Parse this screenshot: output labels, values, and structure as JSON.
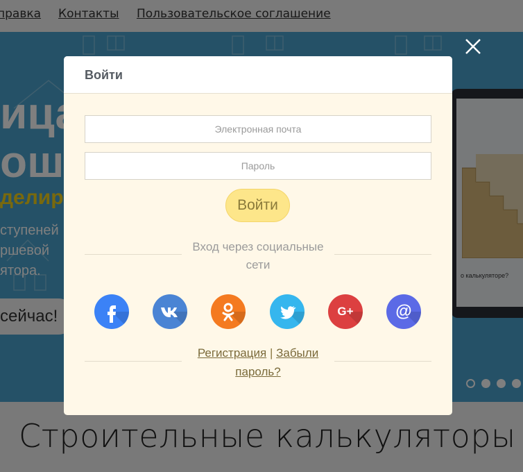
{
  "top_nav": {
    "items": [
      "правка",
      "Контакты",
      "Пользовательское соглашение"
    ]
  },
  "hero": {
    "title_line1": "ица",
    "title_line2": "ошен",
    "accent_text": "делир",
    "text": "ступеней\nршевой\nятора.",
    "button_label": "сейчас!",
    "laptop_question": "о калькуляторе?"
  },
  "slider": {
    "dot_count": 4,
    "active_index": 0
  },
  "page_heading": "Строительные калькуляторы",
  "modal": {
    "title": "Войти",
    "email_placeholder": "Электронная почта",
    "password_placeholder": "Пароль",
    "submit_label": "Войти",
    "social_caption": "Вход через социальные сети",
    "social": [
      {
        "icon": "facebook-icon",
        "glyph": "f",
        "color": "#3b82f6"
      },
      {
        "icon": "vk-icon",
        "glyph": "vk",
        "color": "#4a84d4"
      },
      {
        "icon": "odnoklassniki-icon",
        "glyph": "ok",
        "color": "#f47a20"
      },
      {
        "icon": "twitter-icon",
        "glyph": "tw",
        "color": "#35b6ee"
      },
      {
        "icon": "google-plus-icon",
        "glyph": "G+",
        "color": "#dc4040"
      },
      {
        "icon": "mail-icon",
        "glyph": "@",
        "color": "#5b6ae6"
      }
    ],
    "register_link": "Регистрация",
    "link_separator": "|",
    "forgot_link": "Забыли пароль?"
  },
  "colors": {
    "overlay": "rgba(0,0,0,0.5)",
    "modal_bg": "#fff8e8",
    "button_bg": "#fde68a",
    "hero_bg": "#4aa3cf"
  }
}
